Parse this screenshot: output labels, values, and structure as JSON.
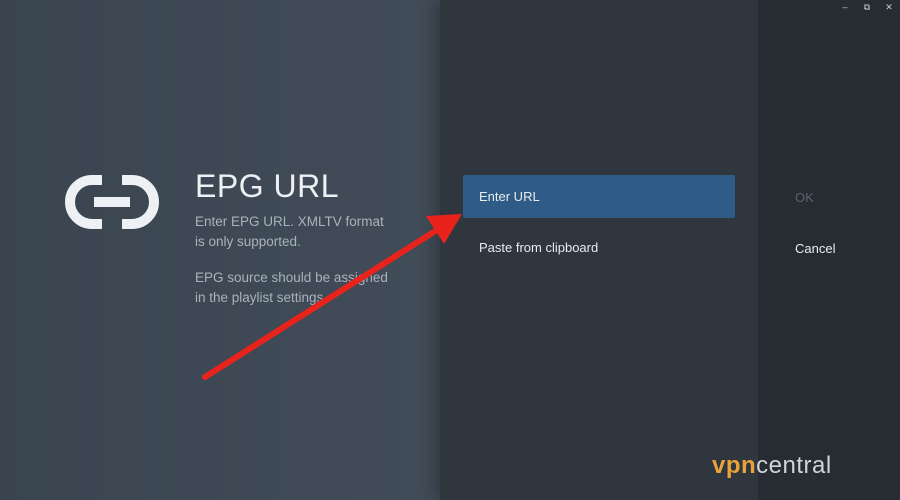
{
  "window": {
    "minimize_glyph": "–",
    "maximize_glyph": "⧉",
    "close_glyph": "✕"
  },
  "info": {
    "icon": "link-icon",
    "title": "EPG URL",
    "description_1": "Enter EPG URL. XMLTV format is only supported.",
    "description_2": "EPG source should be assigned in the playlist settings."
  },
  "options": {
    "enter_url_label": "Enter URL",
    "paste_label": "Paste from clipboard"
  },
  "actions": {
    "ok_label": "OK",
    "cancel_label": "Cancel"
  },
  "watermark": {
    "brand_a": "vpn",
    "brand_b": "central"
  },
  "colors": {
    "selected_option": "#2f5c86",
    "annotation_arrow": "#e8231c",
    "brand_orange": "#e8a33d"
  }
}
